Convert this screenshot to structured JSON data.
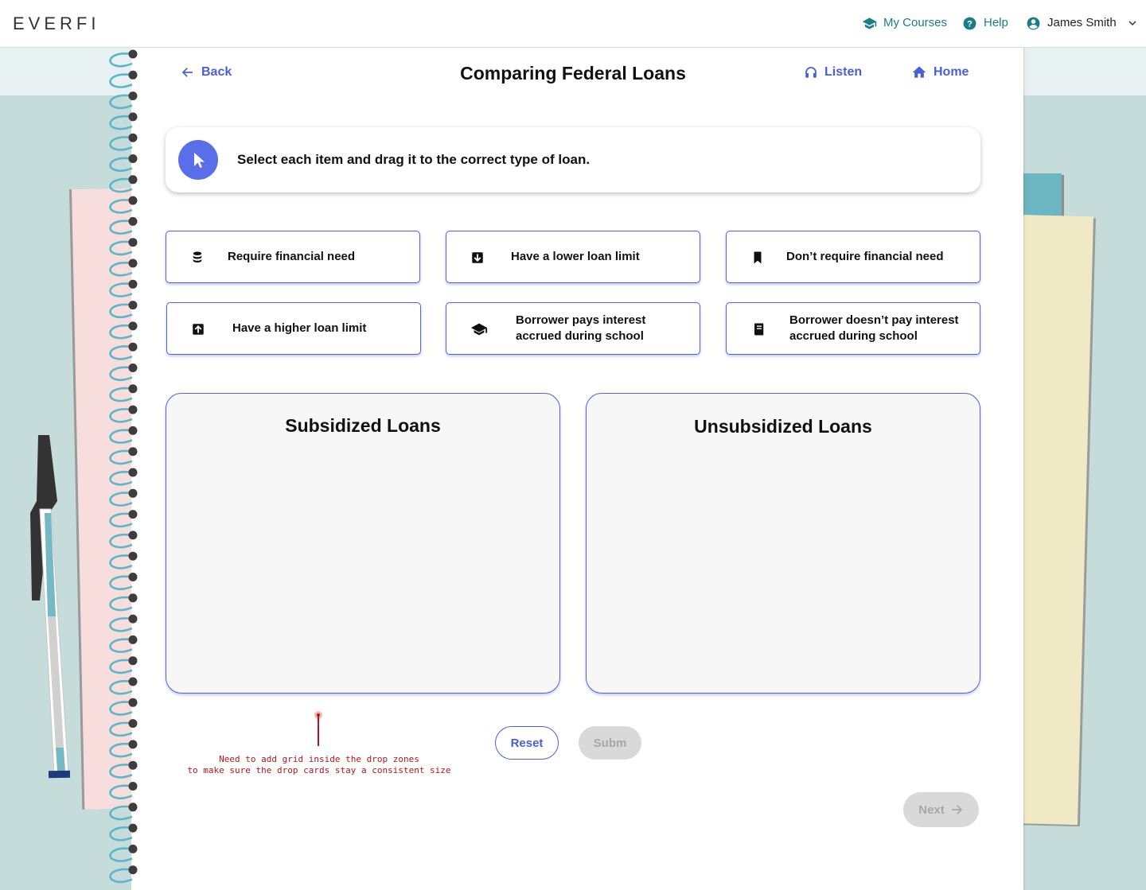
{
  "header": {
    "logo": "EVERFI",
    "my_courses": "My Courses",
    "help": "Help",
    "user_name": "James Smith"
  },
  "page": {
    "back": "Back",
    "title": "Comparing Federal Loans",
    "listen": "Listen",
    "home": "Home"
  },
  "instruction": "Select each item and drag it to the correct type of loan.",
  "cards": [
    {
      "label": "Require financial need",
      "icon": "coins-icon"
    },
    {
      "label": "Have a lower loan limit",
      "icon": "arrow-down-box-icon"
    },
    {
      "label": "Don’t require financial need",
      "icon": "bookmark-icon"
    },
    {
      "label": "Have a higher loan limit",
      "icon": "arrow-up-box-icon"
    },
    {
      "label_1": "Borrower pays interest",
      "label_2": "accrued during school",
      "icon": "graduation-cap-icon"
    },
    {
      "label_1": "Borrower doesn’t pay interest",
      "label_2": "accrued during school",
      "icon": "book-icon"
    }
  ],
  "zones": {
    "subsidized": "Subsidized Loans",
    "unsubsidized": "Unsubsidized Loans"
  },
  "buttons": {
    "reset": "Reset",
    "submit": "Subm",
    "next": "Next"
  },
  "annotation": {
    "line_1": "Need to add grid inside the drop zones",
    "line_2": "to make sure the drop cards stay a consistent size"
  },
  "colors": {
    "accent": "#4a5fd6",
    "teal": "#1a7d87",
    "note": "#b01818"
  }
}
